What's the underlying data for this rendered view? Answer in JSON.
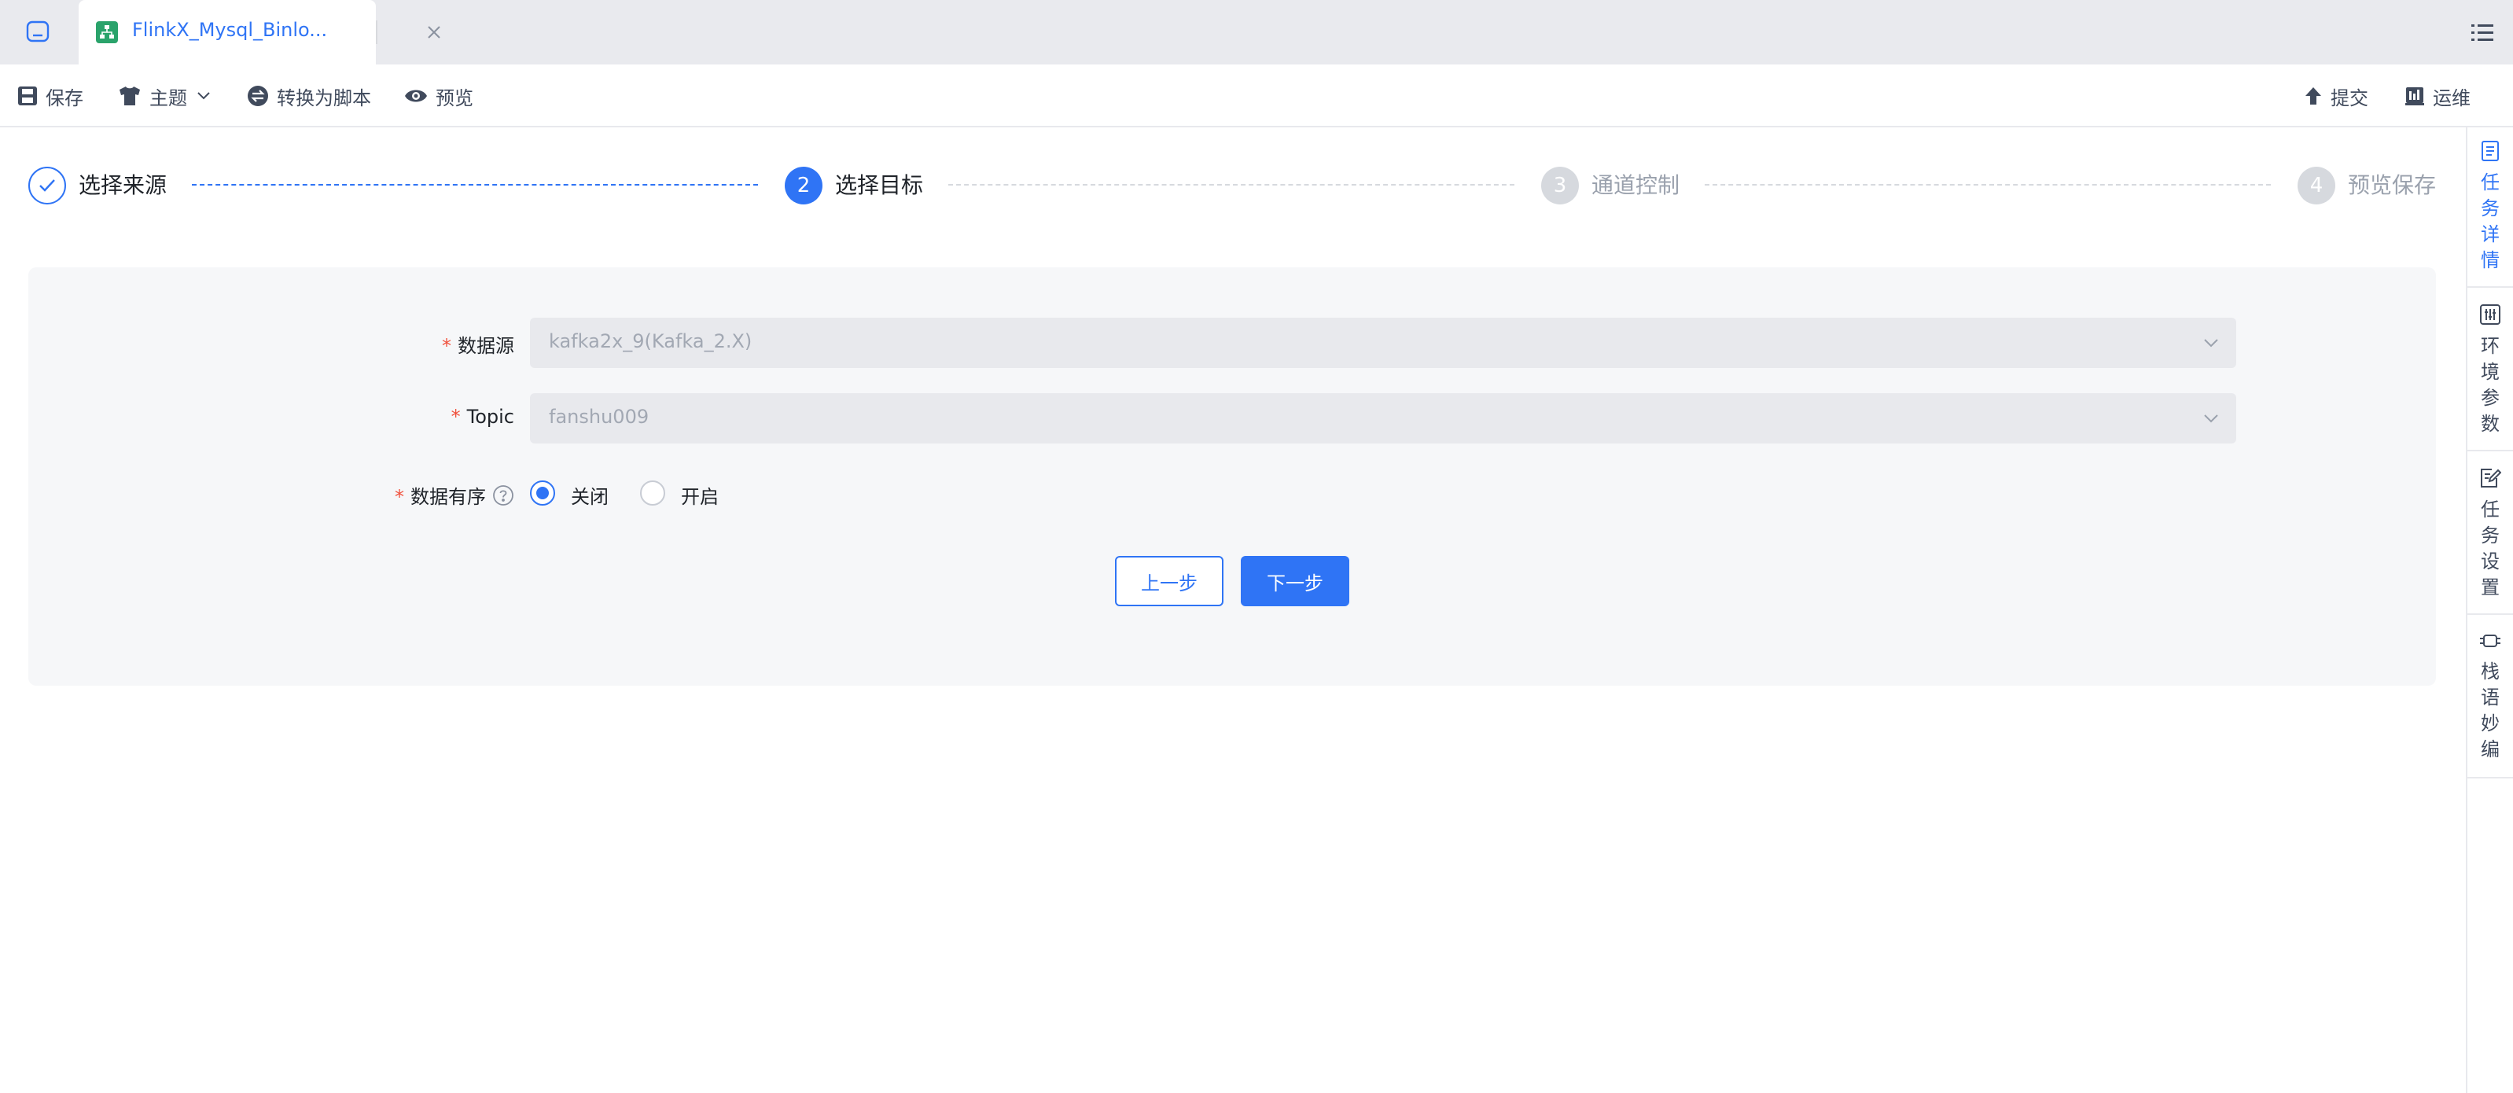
{
  "tabbar": {
    "home_icon": "home-icon",
    "active_tab": {
      "title": "FlinkX_Mysql_Binlo...",
      "icon": "flow-icon"
    },
    "menu_icon": "list-icon"
  },
  "toolbar": {
    "save": "保存",
    "theme": "主题",
    "convert": "转换为脚本",
    "preview": "预览",
    "submit": "提交",
    "ops": "运维"
  },
  "steps": [
    {
      "num": "",
      "label": "选择来源",
      "status": "done"
    },
    {
      "num": "2",
      "label": "选择目标",
      "status": "active"
    },
    {
      "num": "3",
      "label": "通道控制",
      "status": "pending"
    },
    {
      "num": "4",
      "label": "预览保存",
      "status": "pending"
    }
  ],
  "form": {
    "datasource": {
      "label": "数据源",
      "value": "kafka2x_9(Kafka_2.X)"
    },
    "topic": {
      "label": "Topic",
      "value": "fanshu009"
    },
    "ordered": {
      "label": "数据有序",
      "options": [
        "关闭",
        "开启"
      ],
      "selected": "关闭"
    },
    "prev_button": "上一步",
    "next_button": "下一步"
  },
  "rail": [
    {
      "label": "任务详情",
      "icon": "document-icon",
      "active": true
    },
    {
      "label": "环境参数",
      "icon": "sliders-icon",
      "active": false
    },
    {
      "label": "任务设置",
      "icon": "edit-settings-icon",
      "active": false
    },
    {
      "label": "栈语妙编",
      "icon": "stack-code-icon",
      "active": false
    }
  ],
  "colors": {
    "primary": "#2f74f5",
    "required": "#f0513d",
    "panel_bg": "#f6f7f9",
    "tabbar_bg": "#e9eaee",
    "pending": "#c9ccd3"
  }
}
